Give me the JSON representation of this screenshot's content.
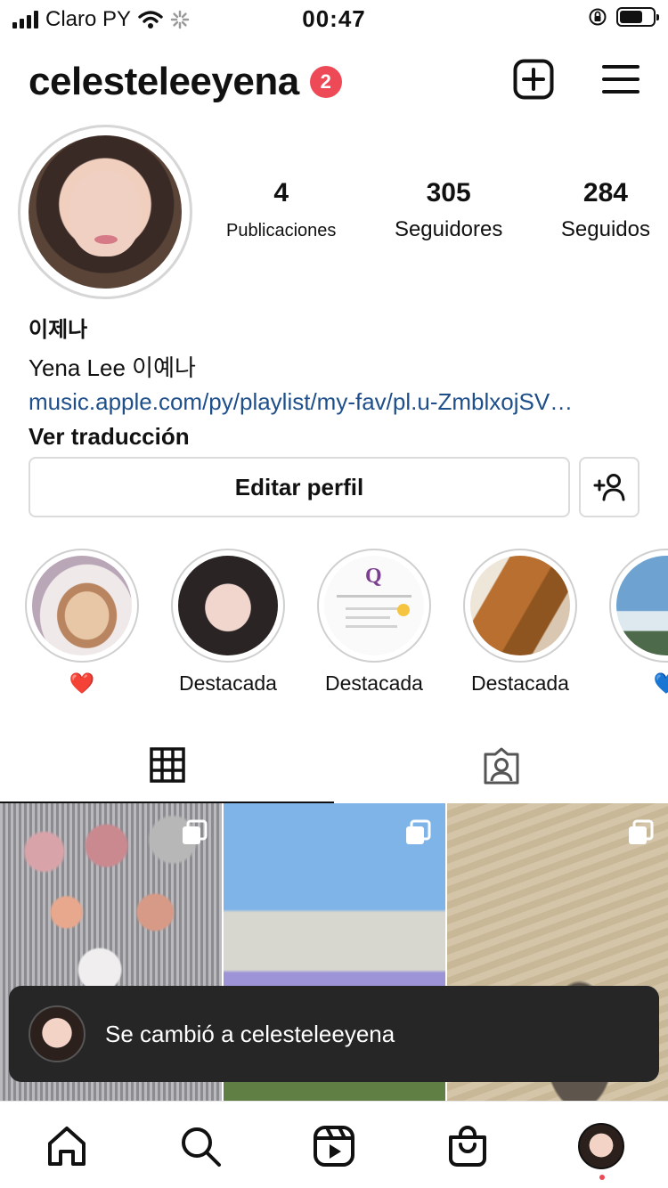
{
  "status_bar": {
    "carrier": "Claro PY",
    "time": "00:47"
  },
  "header": {
    "username": "celesteleeyena",
    "notification_count": "2"
  },
  "profile": {
    "stats": [
      {
        "num": "4",
        "label": "Publicaciones"
      },
      {
        "num": "305",
        "label": "Seguidores"
      },
      {
        "num": "284",
        "label": "Seguidos"
      }
    ],
    "name": "이제나",
    "bio_line": "Yena Lee 이예나",
    "link": "music.apple.com/py/playlist/my-fav/pl.u-ZmblxojSV…",
    "translate": "Ver traducción"
  },
  "buttons": {
    "edit_profile": "Editar perfil"
  },
  "highlights": [
    {
      "label": "❤️"
    },
    {
      "label": "Destacada"
    },
    {
      "label": "Destacada"
    },
    {
      "label": "Destacada"
    },
    {
      "label": "💙"
    }
  ],
  "highlight_doc": {
    "brand": "Q"
  },
  "toast": {
    "text": "Se cambió a celesteleeyena"
  },
  "icons": {
    "status": [
      "cellular-signal-icon",
      "wifi-icon",
      "loading-spinner-icon",
      "orientation-lock-icon",
      "battery-icon"
    ],
    "header": [
      "new-post-icon",
      "menu-icon"
    ],
    "tabs": [
      "grid-icon",
      "tagged-icon"
    ],
    "bottom_nav": [
      "home-icon",
      "search-icon",
      "reels-icon",
      "shop-icon",
      "profile-avatar"
    ]
  },
  "colors": {
    "badge": "#ed4956",
    "link": "#1e4f8a",
    "toast_bg": "#262626"
  }
}
